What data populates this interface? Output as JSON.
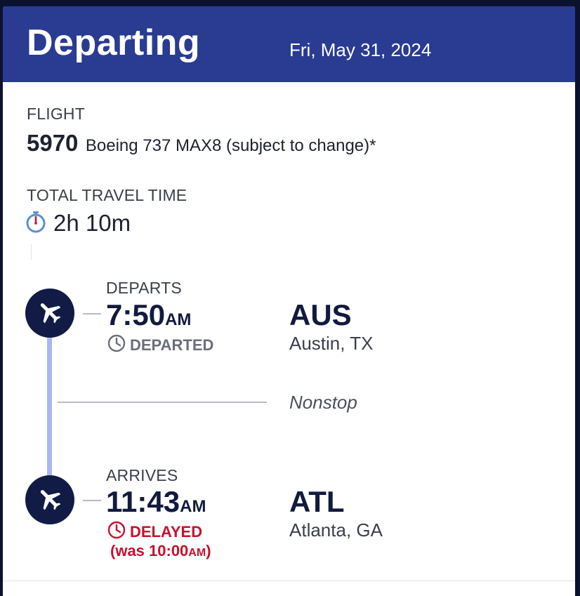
{
  "header": {
    "title": "Departing",
    "date": "Fri, May 31, 2024",
    "background_color": "#2a3b92"
  },
  "flight": {
    "label": "FLIGHT",
    "number": "5970",
    "aircraft": "Boeing 737 MAX8 (subject to change)*"
  },
  "travel": {
    "label": "TOTAL TRAVEL TIME",
    "icon": "stopwatch-icon",
    "duration": "2h 10m"
  },
  "departure": {
    "label": "DEPARTS",
    "time": "7:50",
    "ampm": "AM",
    "status_icon": "clock-icon",
    "status": "DEPARTED",
    "status_color": "#6b6f7a",
    "airport_code": "AUS",
    "city": "Austin, TX",
    "icon": "airplane-icon"
  },
  "segment": {
    "type": "Nonstop"
  },
  "arrival": {
    "label": "ARRIVES",
    "time": "11:43",
    "ampm": "AM",
    "status_icon": "clock-icon",
    "status": "DELAYED",
    "status_color": "#c8102e",
    "was_prefix": "(was 10:00",
    "was_ampm": "AM",
    "was_suffix": ")",
    "airport_code": "ATL",
    "city": "Atlanta, GA",
    "icon": "airplane-icon"
  },
  "colors": {
    "plane_badge": "#111b45",
    "route_line": "#a9b8f2",
    "delay_red": "#c8102e"
  }
}
